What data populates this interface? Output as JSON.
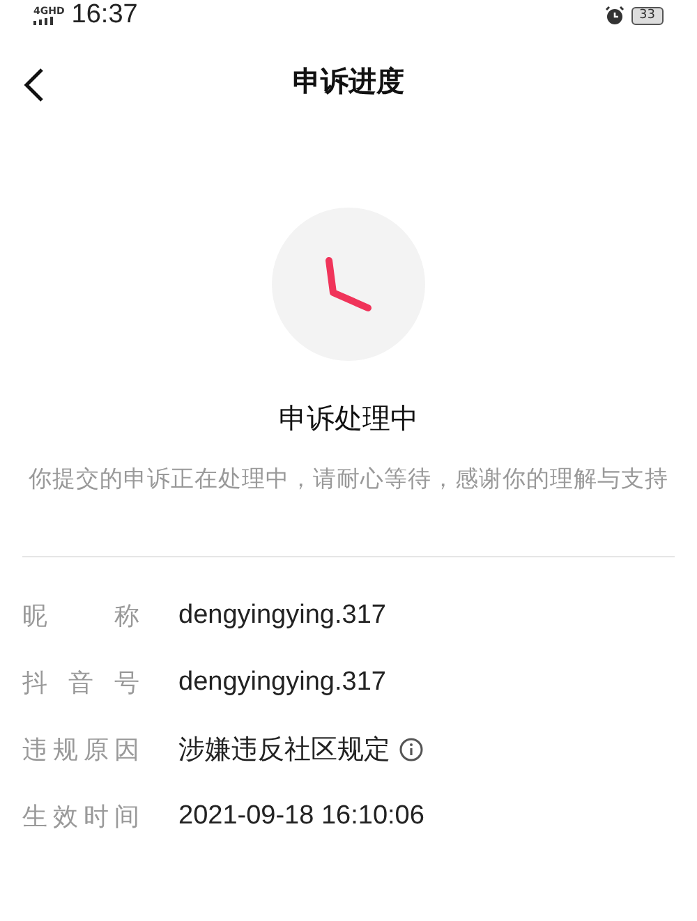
{
  "status_bar": {
    "network": "4GHD",
    "time": "16:37",
    "battery": "33"
  },
  "nav": {
    "title": "申诉进度"
  },
  "status": {
    "title": "申诉处理中",
    "description": "你提交的申诉正在处理中，请耐心等待，感谢你的理解与支持"
  },
  "details": [
    {
      "label": "昵称",
      "value": "dengyingying.317",
      "kind": "text"
    },
    {
      "label": "抖音号",
      "value": "dengyingying.317",
      "kind": "text"
    },
    {
      "label": "违规原因",
      "value": "涉嫌违反社区规定",
      "kind": "info"
    },
    {
      "label": "生效时间",
      "value": "2021-09-18 16:10:06",
      "kind": "text"
    }
  ]
}
